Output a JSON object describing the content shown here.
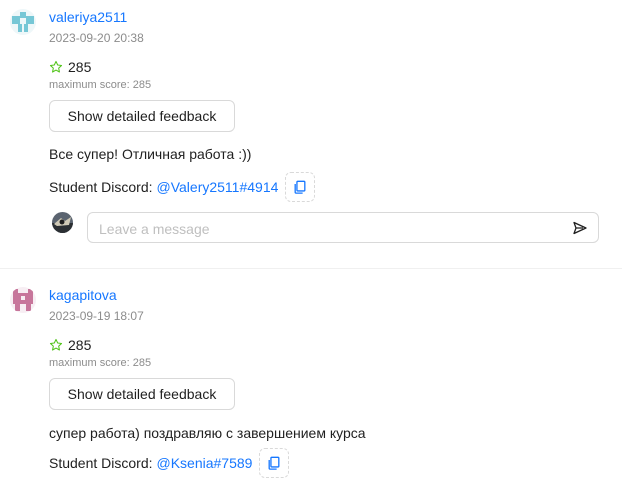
{
  "entries": [
    {
      "user": "valeriya2511",
      "date": "2023-09-20 20:38",
      "score": "285",
      "max_score": "maximum score: 285",
      "button": "Show detailed feedback",
      "comment": "Все супер! Отличная работа :))",
      "discord_label": "Student Discord:",
      "discord_handle": "@Valery2511#4914",
      "avatar_icon": "identicon-teal",
      "avatar_color": "#76c7d6"
    },
    {
      "user": "kagapitova",
      "date": "2023-09-19 18:07",
      "score": "285",
      "max_score": "maximum score: 285",
      "button": "Show detailed feedback",
      "comment": "супер работа) поздравляю с завершением курса",
      "discord_label": "Student Discord:",
      "discord_handle": "@Ksenia#7589",
      "avatar_icon": "identicon-pink",
      "avatar_color": "#c7769b"
    }
  ],
  "message": {
    "placeholder": "Leave a message"
  },
  "colors": {
    "link": "#1677ff",
    "star": "#52c41a",
    "muted": "#8c8c8c"
  }
}
